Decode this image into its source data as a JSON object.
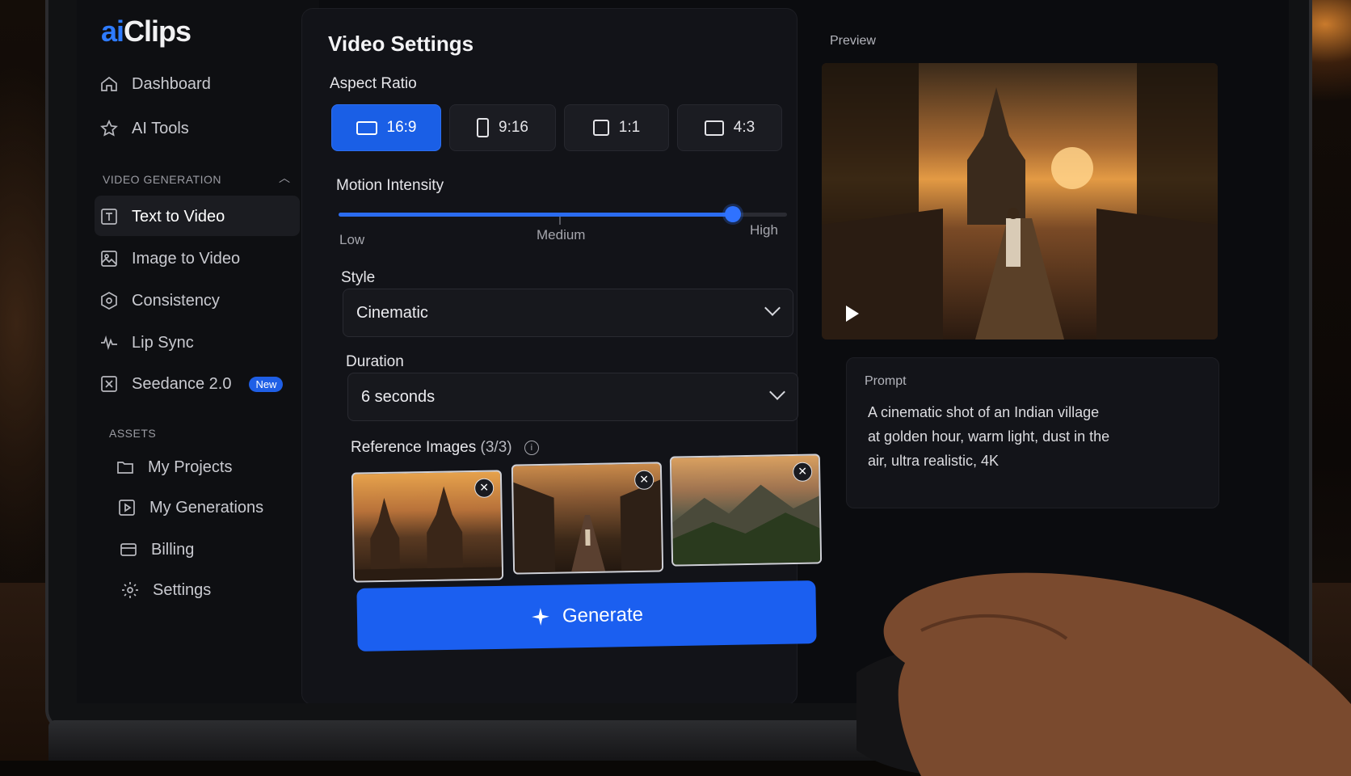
{
  "brand": {
    "ai": "ai",
    "clips": "Clips"
  },
  "sidebar": {
    "top_items": [
      {
        "label": "Dashboard",
        "icon": "home-icon"
      },
      {
        "label": "AI Tools",
        "icon": "star-icon"
      }
    ],
    "section_video": "VIDEO GENERATION",
    "video_items": [
      {
        "label": "Text to Video",
        "icon": "text-box-icon",
        "active": true
      },
      {
        "label": "Image to Video",
        "icon": "image-icon"
      },
      {
        "label": "Consistency",
        "icon": "hexagon-icon"
      },
      {
        "label": "Lip Sync",
        "icon": "waveform-icon"
      },
      {
        "label": "Seedance 2.0",
        "icon": "seedance-icon",
        "badge": "New"
      }
    ],
    "section_assets": "ASSETS",
    "asset_items": [
      {
        "label": "My Projects",
        "icon": "folder-icon"
      },
      {
        "label": "My Generations",
        "icon": "play-square-icon"
      },
      {
        "label": "Billing",
        "icon": "card-icon"
      },
      {
        "label": "Settings",
        "icon": "gear-icon"
      }
    ]
  },
  "settings": {
    "title": "Video Settings",
    "aspect_ratio_label": "Aspect Ratio",
    "ratios": [
      {
        "label": "16:9",
        "selected": true
      },
      {
        "label": "9:16",
        "selected": false
      },
      {
        "label": "1:1",
        "selected": false
      },
      {
        "label": "4:3",
        "selected": false
      }
    ],
    "motion_label": "Motion Intensity",
    "motion_value_fraction": 0.88,
    "motion_low": "Low",
    "motion_medium": "Medium",
    "motion_high": "High",
    "style_label": "Style",
    "style_value": "Cinematic",
    "duration_label": "Duration",
    "duration_value": "6 seconds",
    "reference_label": "Reference Images",
    "reference_count": "(3/3)",
    "generate_label": "Generate"
  },
  "preview": {
    "label": "Preview",
    "prompt_label": "Prompt",
    "prompt_text": "A cinematic shot of an Indian village at golden hour, warm light, dust in the air, ultra realistic, 4K"
  },
  "colors": {
    "accent": "#1b5ff0",
    "brand_ai": "#2e7bff"
  }
}
